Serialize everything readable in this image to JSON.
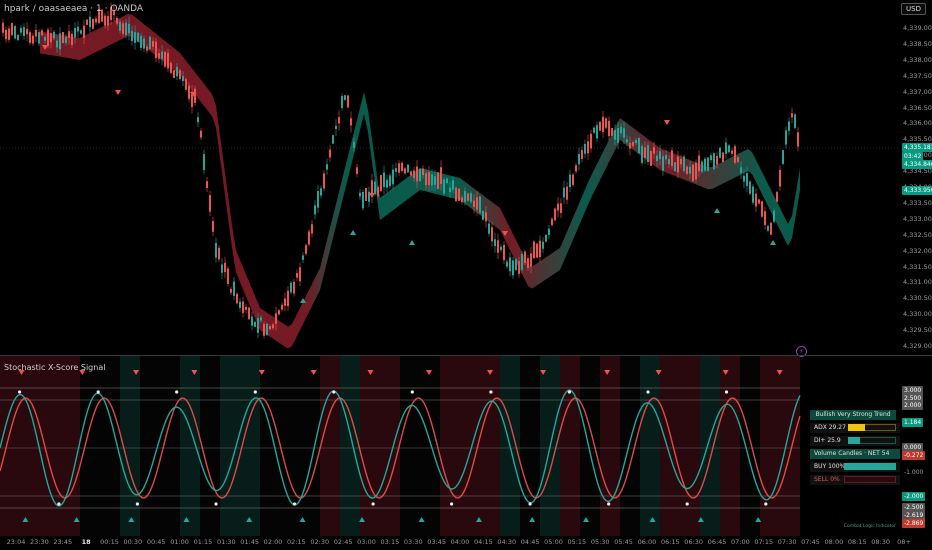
{
  "header": {
    "symbol": "hpark / oaasaeaea · 1 · OANDA",
    "currency": "USD",
    "indicator_title": "Stochastic X-Score Signal"
  },
  "price_axis": {
    "labels": [
      "4,339.000",
      "4,338.500",
      "4,338.000",
      "4,337.500",
      "4,337.000",
      "4,336.500",
      "4,336.000",
      "4,335.500",
      "4,335.000",
      "4,334.500",
      "4,334.000",
      "4,333.500",
      "4,333.000",
      "4,332.500",
      "4,332.000",
      "4,331.500",
      "4,331.000",
      "4,330.500",
      "4,330.000",
      "4,329.500",
      "4,329.000"
    ],
    "badges": [
      {
        "text": "4,335.183",
        "color": "#089981"
      },
      {
        "text": "03:42",
        "color": "#089981"
      },
      {
        "text": "4,334.846",
        "color": "#089981"
      },
      {
        "text": "4,333.956",
        "color": "#089981"
      }
    ]
  },
  "indicator_axis": {
    "labels": [
      {
        "text": "3.000",
        "color": "#555555"
      },
      {
        "text": "2.500",
        "color": "#555555"
      },
      {
        "text": "2.000",
        "color": "#555555"
      },
      {
        "text": "1.184",
        "color": "#089981"
      },
      {
        "text": "0.000",
        "color": "#555555"
      },
      {
        "text": "-0.272",
        "color": "#c0392b"
      },
      {
        "text": "-1.000",
        "color": "#000000"
      },
      {
        "text": "-2.000",
        "color": "#089981"
      },
      {
        "text": "-2.500",
        "color": "#555555"
      },
      {
        "text": "-2.619",
        "color": "#555555"
      },
      {
        "text": "-2.869",
        "color": "#c0392b"
      }
    ]
  },
  "dashboard": {
    "trend": "Bullish Very Strong Trend",
    "adx": "ADX 29.27",
    "adx_fill": 0.35,
    "di": "DI+ 25.9",
    "di_fill": 0.26,
    "volume": "Volume Candles · NET 54",
    "buy": "BUY 100%",
    "buy_fill": 1.0,
    "sell": "SELL 0%",
    "sell_fill": 0.0,
    "footer": "Combat Logic Indicator"
  },
  "time_axis": {
    "ticks": [
      "23:04",
      "23:30",
      "23:45",
      "18",
      "00:15",
      "00:30",
      "00:45",
      "01:00",
      "01:15",
      "01:30",
      "01:45",
      "02:00",
      "02:15",
      "02:30",
      "02:45",
      "03:00",
      "03:15",
      "03:30",
      "03:45",
      "04:00",
      "04:15",
      "04:30",
      "04:45",
      "05:00",
      "05:15",
      "05:30",
      "05:45",
      "06:00",
      "06:15",
      "06:30",
      "06:45",
      "07:00",
      "07:15",
      "07:30",
      "07:45",
      "08:00",
      "08:15",
      "08:30",
      "08+"
    ],
    "bold_tick": "18"
  },
  "colors": {
    "bull": "#26a69a",
    "bear": "#ef5350",
    "ribbon_bull": "#0d6b5a",
    "ribbon_bear": "#8a1f2b",
    "background": "#000000"
  }
}
